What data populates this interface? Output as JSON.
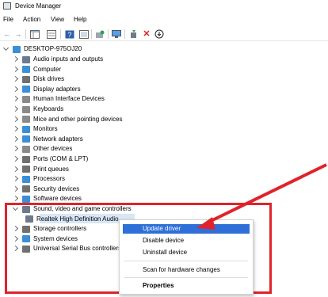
{
  "window": {
    "title": "Device Manager",
    "icon": "device-manager-icon"
  },
  "menubar": [
    "File",
    "Action",
    "View",
    "Help"
  ],
  "toolbar": {
    "buttons": [
      "back-icon",
      "forward-icon",
      "show-hide-console-tree-icon",
      "properties-icon",
      "help-icon",
      "show-hidden-icon",
      "scan-hardware-icon",
      "monitor-icon",
      "update-driver-icon",
      "uninstall-icon",
      "download-icon"
    ]
  },
  "tree": {
    "root": "DESKTOP-975OJ20",
    "categories": [
      {
        "label": "Audio inputs and outputs",
        "icon": "speaker-icon",
        "color": "#6b7a8c"
      },
      {
        "label": "Computer",
        "icon": "computer-icon",
        "color": "#3a8fd6"
      },
      {
        "label": "Disk drives",
        "icon": "disk-drive-icon",
        "color": "#707070"
      },
      {
        "label": "Display adapters",
        "icon": "display-adapter-icon",
        "color": "#3a8fd6"
      },
      {
        "label": "Human Interface Devices",
        "icon": "hid-icon",
        "color": "#8a8a8a"
      },
      {
        "label": "Keyboards",
        "icon": "keyboard-icon",
        "color": "#8a8a8a"
      },
      {
        "label": "Mice and other pointing devices",
        "icon": "mouse-icon",
        "color": "#8a8a8a"
      },
      {
        "label": "Monitors",
        "icon": "monitor-icon",
        "color": "#3a8fd6"
      },
      {
        "label": "Network adapters",
        "icon": "network-adapter-icon",
        "color": "#3a8fd6"
      },
      {
        "label": "Other devices",
        "icon": "other-devices-icon",
        "color": "#8a8a8a"
      },
      {
        "label": "Ports (COM & LPT)",
        "icon": "port-icon",
        "color": "#707070"
      },
      {
        "label": "Print queues",
        "icon": "printer-icon",
        "color": "#707070"
      },
      {
        "label": "Processors",
        "icon": "processor-icon",
        "color": "#3a8fd6"
      },
      {
        "label": "Security devices",
        "icon": "security-icon",
        "color": "#707070"
      },
      {
        "label": "Software devices",
        "icon": "software-device-icon",
        "color": "#3a8fd6"
      },
      {
        "label": "Sound, video and game controllers",
        "icon": "sound-icon",
        "color": "#6b7a8c"
      },
      {
        "label": "Realtek High Definition Audio",
        "icon": "speaker-icon",
        "color": "#6b7a8c"
      },
      {
        "label": "Storage controllers",
        "icon": "storage-icon",
        "color": "#707070"
      },
      {
        "label": "System devices",
        "icon": "system-icon",
        "color": "#3a8fd6"
      },
      {
        "label": "Universal Serial Bus controllers",
        "icon": "usb-icon",
        "color": "#707070"
      }
    ]
  },
  "context_menu": {
    "items": [
      "Update driver",
      "Disable device",
      "Uninstall device",
      "Scan for hardware changes",
      "Properties"
    ]
  },
  "colors": {
    "highlight": "#e0232b",
    "selection": "#d8e6f5",
    "menu_hover": "#2e6fd8"
  }
}
